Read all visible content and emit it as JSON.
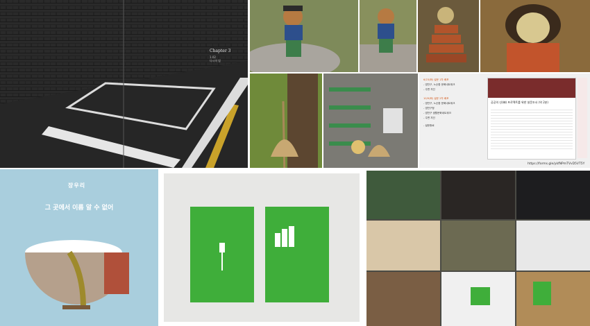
{
  "book_spread": {
    "chapter_title": "Chapter 3",
    "chapter_sub1": "1.02",
    "chapter_sub2": "다시의 밤"
  },
  "survey_panel": {
    "items": [
      "6/23(화) 설문 1차 배포",
      "- 영천구, 노순환 문화네트워크",
      "- 주변 지인",
      "10/9(화) 설문 2차 배포",
      "- 영천구, 노순환 문화네트워크",
      "- 영천구청",
      "- 영천구 생활문화네트워크",
      "- 주변 지인",
      "- 설문종료"
    ],
    "form_title": "공공의 신(神) 프로젝트를 위한 설문조사 (약 2분)",
    "url": "https://forms.gle/ykfNPmTVvD5VT5Y"
  },
  "album": {
    "singer": "장우리",
    "arc_text": "그 곳에서 이름 알 수 없어"
  },
  "colors": {
    "green": "#3fae3a",
    "book_bg": "#202020",
    "album_bg": "#a9cedd"
  }
}
